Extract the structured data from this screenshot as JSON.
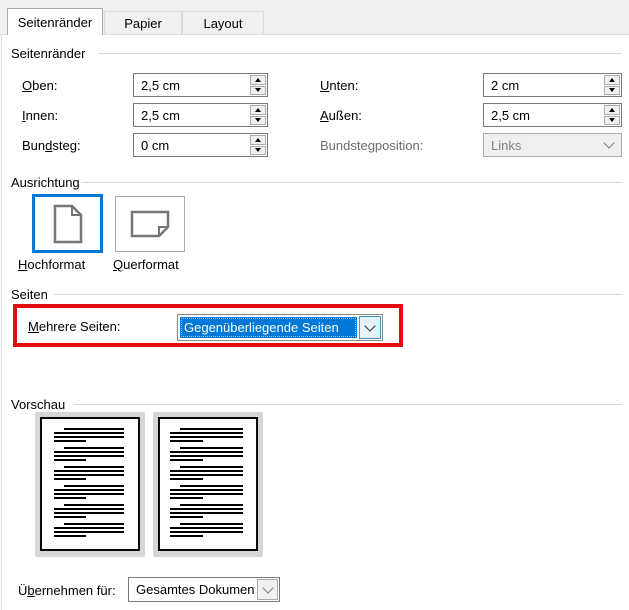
{
  "colors": {
    "accent_blue": "#0078d7",
    "annotation_red": "#e10b12",
    "selection_text": "#ffffff",
    "disabled_text": "#838383"
  },
  "tabs": {
    "seitenraender": "Seitenränder",
    "papier": "Papier",
    "layout": "Layout"
  },
  "margins": {
    "group_title": "Seitenränder",
    "oben": {
      "key": "O",
      "rest": "ben:",
      "value": "2,5 cm"
    },
    "unten": {
      "key": "U",
      "rest": "nten:",
      "value": "2 cm"
    },
    "innen": {
      "key": "I",
      "rest": "nnen:",
      "value": "2,5 cm"
    },
    "aussen": {
      "key": "A",
      "rest": "ußen:",
      "value": "2,5 cm"
    },
    "bundsteg": {
      "pre": "Bun",
      "key": "d",
      "rest": "steg:",
      "value": "0 cm"
    },
    "bundstegposition": {
      "label": "Bundstegposition:",
      "value": "Links",
      "disabled": true
    }
  },
  "orientation": {
    "group_title": "Ausrichtung",
    "portrait": {
      "key": "H",
      "rest": "ochformat",
      "selected": true
    },
    "landscape": {
      "key": "Q",
      "rest": "uerformat",
      "selected": false
    }
  },
  "pages": {
    "group_title": "Seiten",
    "mehrere_seiten": {
      "key": "M",
      "rest": "ehrere Seiten:",
      "value": "Gegenüberliegende Seiten"
    }
  },
  "preview": {
    "group_title": "Vorschau",
    "page_count": 2,
    "paragraphs_per_page": 6
  },
  "apply": {
    "pre": "Ü",
    "key": "b",
    "rest": "ernehmen für:",
    "value": "Gesamtes Dokument"
  }
}
